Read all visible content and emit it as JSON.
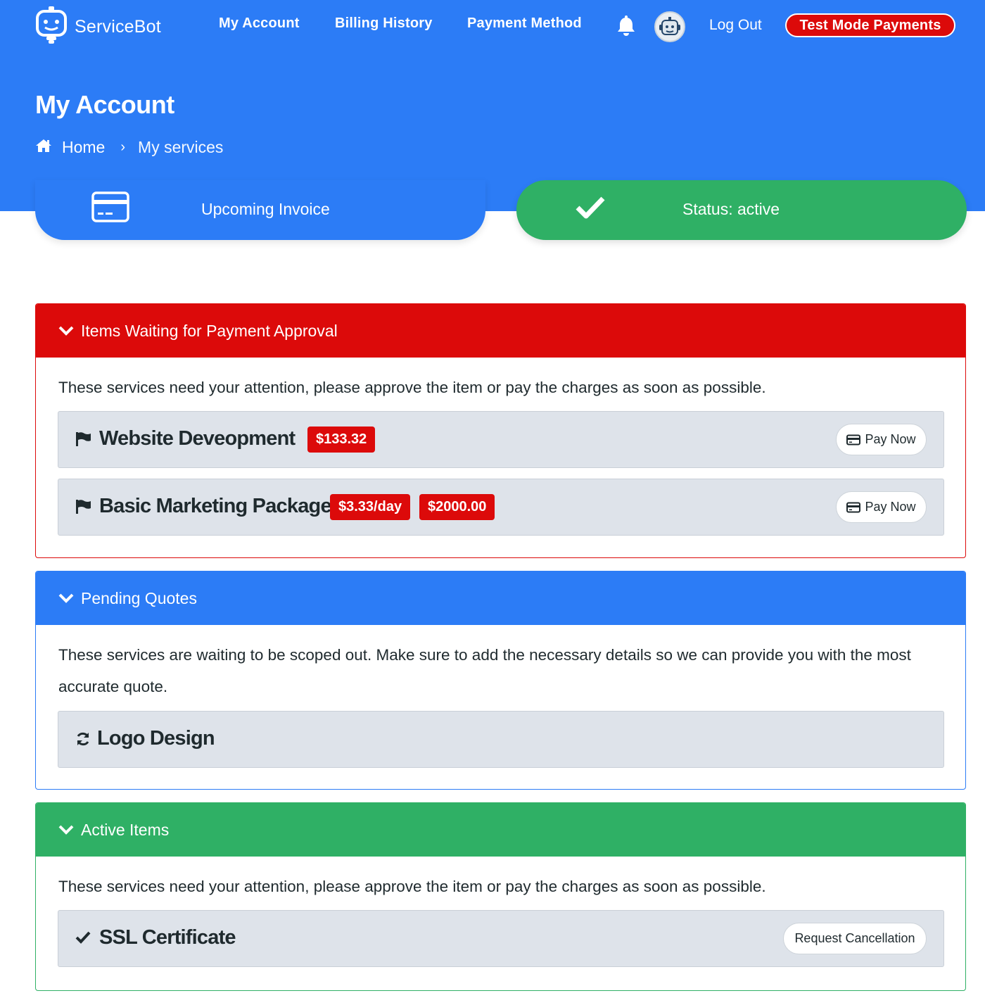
{
  "colors": {
    "primary": "#2c7cf6",
    "danger": "#dc0a0a",
    "success": "#2fb065",
    "item_bg": "#dee3ea"
  },
  "nav": {
    "brand": "ServiceBot",
    "links": [
      "My Account",
      "Billing History",
      "Payment Method"
    ],
    "logout": "Log Out",
    "test_mode": "Test Mode Payments",
    "icons": [
      "servicebot-logo-icon",
      "bell-icon",
      "avatar"
    ]
  },
  "page": {
    "title": "My Account",
    "breadcrumb": {
      "home": "Home",
      "current": "My services"
    }
  },
  "cards": {
    "invoice": "Upcoming Invoice",
    "status": "Status: active"
  },
  "sections": {
    "waiting": {
      "title": "Items Waiting for Payment Approval",
      "description": "These services need your attention, please approve the item or pay the charges as soon as possible.",
      "items": [
        {
          "name": "Website Deveopment",
          "badges": [
            "$133.32"
          ],
          "action": "Pay Now"
        },
        {
          "name": "Basic Marketing Package",
          "badges": [
            "$3.33/day",
            "$2000.00"
          ],
          "action": "Pay Now"
        }
      ]
    },
    "quotes": {
      "title": "Pending Quotes",
      "description": "These services are waiting to be scoped out. Make sure to add the necessary details so we can provide you with the most accurate quote.",
      "items": [
        {
          "name": "Logo Design"
        }
      ]
    },
    "active": {
      "title": "Active Items",
      "description": "These services need your attention, please approve the item or pay the charges as soon as possible.",
      "items": [
        {
          "name": "SSL Certificate",
          "action": "Request Cancellation"
        }
      ]
    }
  }
}
